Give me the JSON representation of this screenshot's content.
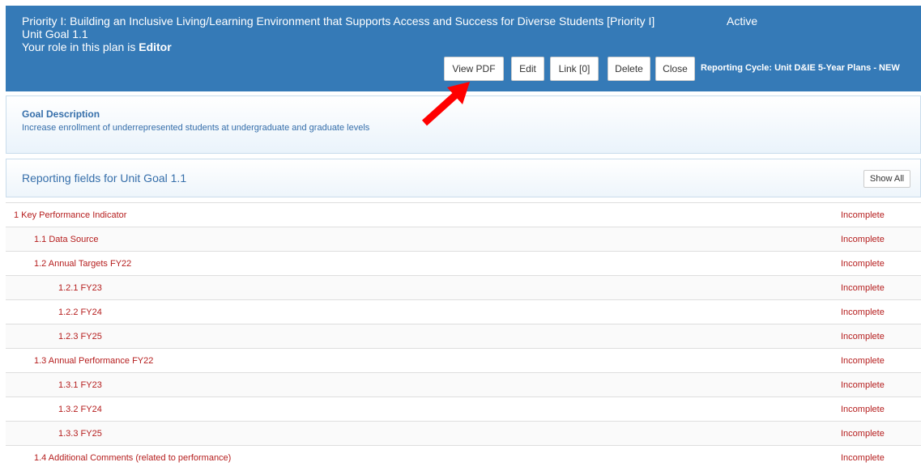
{
  "header": {
    "title": "Priority I: Building an Inclusive Living/Learning Environment that Supports Access and Success for Diverse Students [Priority I]",
    "status": "Active",
    "goal": "Unit Goal 1.1",
    "role_prefix": "Your role in this plan is ",
    "role": "Editor",
    "buttons": {
      "view_pdf": "View PDF",
      "edit": "Edit",
      "link": "Link [0]",
      "delete": "Delete",
      "close": "Close"
    },
    "cycle_label": "Reporting Cycle:",
    "cycle_value": " Unit D&IE 5-Year Plans - NEW"
  },
  "goal_description": {
    "label": "Goal Description",
    "text": "Increase enrollment of underrepresented students at undergraduate and graduate levels"
  },
  "reporting": {
    "title": "Reporting fields for Unit Goal 1.1",
    "show_all": "Show All",
    "rows": [
      {
        "name": "1 Key Performance Indicator",
        "status": "Incomplete"
      },
      {
        "name": "1.1 Data Source",
        "status": "Incomplete"
      },
      {
        "name": "1.2 Annual Targets FY22",
        "status": "Incomplete"
      },
      {
        "name": "1.2.1 FY23",
        "status": "Incomplete"
      },
      {
        "name": "1.2.2 FY24",
        "status": "Incomplete"
      },
      {
        "name": "1.2.3 FY25",
        "status": "Incomplete"
      },
      {
        "name": "1.3 Annual Performance FY22",
        "status": "Incomplete"
      },
      {
        "name": "1.3.1 FY23",
        "status": "Incomplete"
      },
      {
        "name": "1.3.2 FY24",
        "status": "Incomplete"
      },
      {
        "name": "1.3.3 FY25",
        "status": "Incomplete"
      },
      {
        "name": "1.4 Additional Comments (related to performance)",
        "status": "Incomplete"
      }
    ]
  },
  "colors": {
    "header_bg": "#357ab7",
    "panel_text": "#356eaa",
    "incomplete": "#b51d1d",
    "annotation_arrow": "#ff0000"
  },
  "icons": {
    "annotation": "red-arrow-icon"
  }
}
